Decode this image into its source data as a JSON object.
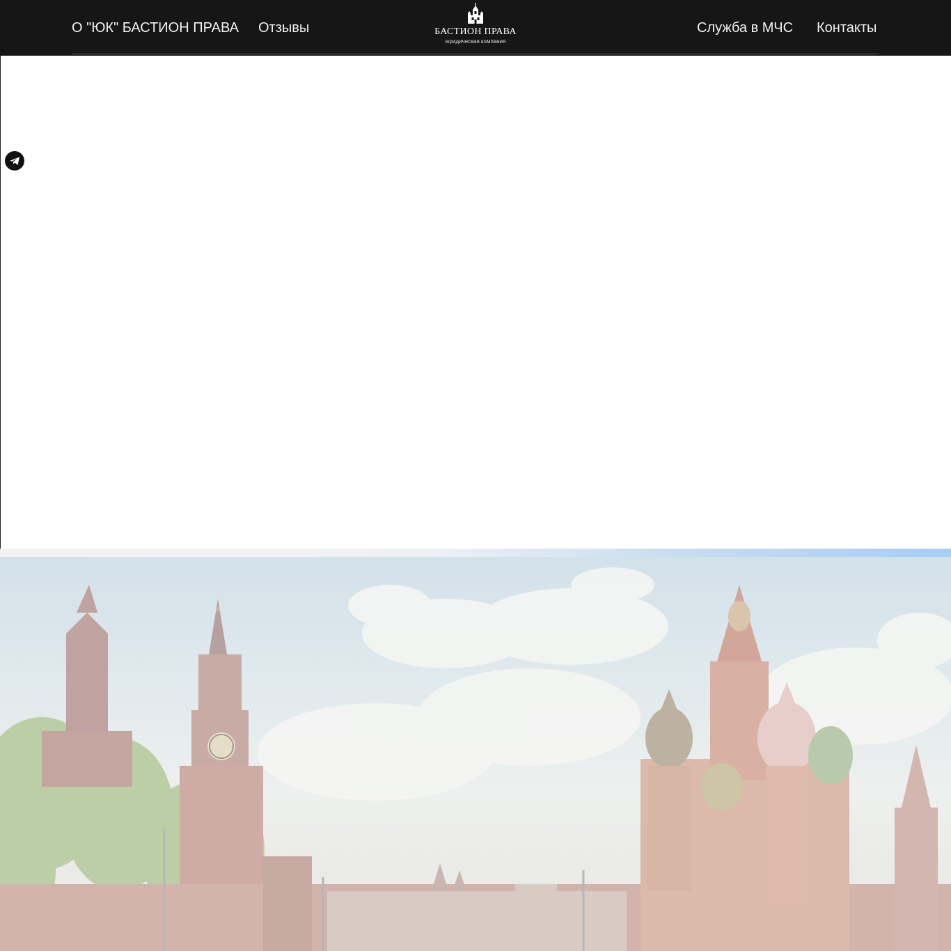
{
  "nav": {
    "left": [
      {
        "label": "О \"ЮК\" БАСТИОН ПРАВА"
      },
      {
        "label": "Отзывы"
      }
    ],
    "right": [
      {
        "label": "Служба в МЧС"
      },
      {
        "label": "Контакты"
      }
    ]
  },
  "logo": {
    "title": "БАСТИОН ПРАВА",
    "subtitle": "юридическая компания",
    "icon": "castle-icon"
  },
  "floating": {
    "telegram_icon": "telegram-icon"
  },
  "hero": {
    "image": "moscow-red-square-photo"
  },
  "colors": {
    "header_bg": "#161616",
    "nav_text": "#f1f1f1",
    "page_bg": "#ffffff"
  }
}
